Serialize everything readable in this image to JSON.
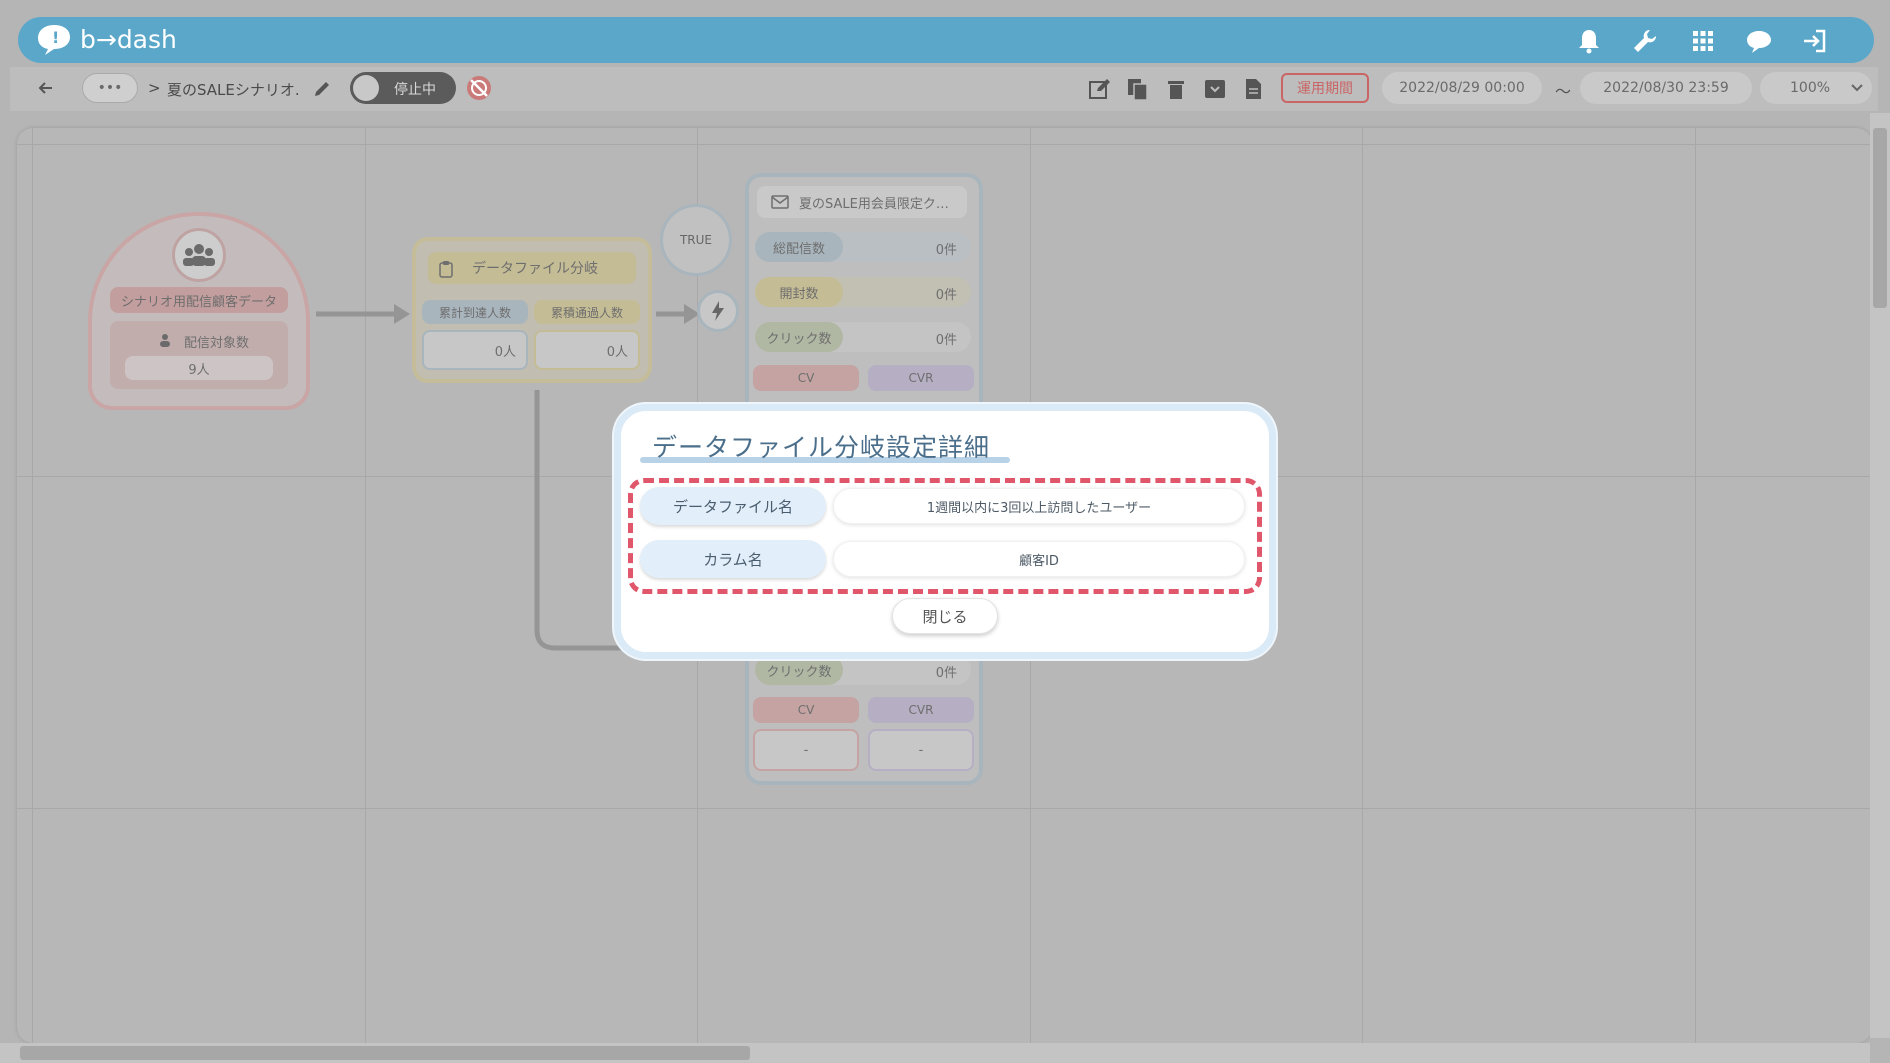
{
  "app": {
    "logo_text": "b→dash"
  },
  "header": {
    "icons": [
      "bell-icon",
      "wrench-icon",
      "apps-grid-icon",
      "chat-icon",
      "logout-icon"
    ]
  },
  "toolbar": {
    "back_icon": "arrow-left-icon",
    "more_label": "•••",
    "breadcrumb_sep": ">",
    "scenario_name": "夏のSALEシナリオ.",
    "status_label": "停止中",
    "period_label": "運用期間",
    "start_date": "2022/08/29 00:00",
    "range_sep": "〜",
    "end_date": "2022/08/30 23:59",
    "zoom": "100%"
  },
  "canvas": {
    "source_node": {
      "title": "シナリオ用配信顧客データ",
      "metric_label": "配信対象数",
      "metric_value": "9人"
    },
    "branch_node": {
      "title": "データファイル分岐",
      "col1_label": "累計到達人数",
      "col2_label": "累積通過人数",
      "col1_value": "0人",
      "col2_value": "0人"
    },
    "true_label": "TRUE",
    "mail_node_top": {
      "title": "夏のSALE用会員限定ク…",
      "rows": [
        {
          "label": "総配信数",
          "value": "0件"
        },
        {
          "label": "開封数",
          "value": "0件"
        },
        {
          "label": "クリック数",
          "value": "0件"
        }
      ],
      "cv_label": "CV",
      "cvr_label": "CVR"
    },
    "mail_node_bottom": {
      "click_label": "クリック数",
      "click_value": "0件",
      "cv_label": "CV",
      "cvr_label": "CVR",
      "cv_value": "-",
      "cvr_value": "-"
    }
  },
  "modal": {
    "title": "データファイル分岐設定詳細",
    "rows": [
      {
        "label": "データファイル名",
        "value": "1週間以内に3回以上訪問したユーザー"
      },
      {
        "label": "カラム名",
        "value": "顧客ID"
      }
    ],
    "close_label": "閉じる"
  },
  "colors": {
    "header": "#5aa7c9",
    "highlight_dash": "#e0566a",
    "overlay": "#b5b5b5"
  }
}
